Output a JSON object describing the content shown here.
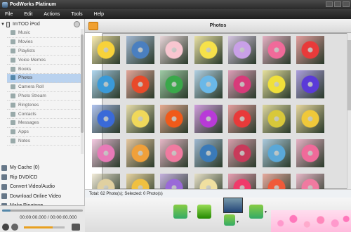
{
  "window": {
    "title": "PodWorks Platinum"
  },
  "menu": [
    "File",
    "Edit",
    "Actions",
    "Tools",
    "Help"
  ],
  "device": {
    "name": "ImTOO iPod"
  },
  "nav": [
    {
      "label": "Music",
      "icon": "music-note-icon"
    },
    {
      "label": "Movies",
      "icon": "film-icon"
    },
    {
      "label": "Playlists",
      "icon": "playlist-icon"
    },
    {
      "label": "Voice Memos",
      "icon": "microphone-icon"
    },
    {
      "label": "Books",
      "icon": "book-icon"
    },
    {
      "label": "Photos",
      "icon": "photo-icon",
      "active": true
    },
    {
      "label": "Camera Roll",
      "icon": "camera-icon"
    },
    {
      "label": "Photo Stream",
      "icon": "cloud-icon"
    },
    {
      "label": "Ringtones",
      "icon": "bell-icon"
    },
    {
      "label": "Contacts",
      "icon": "contacts-icon"
    },
    {
      "label": "Messages",
      "icon": "message-icon"
    },
    {
      "label": "Apps",
      "icon": "apps-icon"
    },
    {
      "label": "Notes",
      "icon": "notes-icon"
    }
  ],
  "tools": [
    {
      "label": "My Cache (0)",
      "icon": "cache-icon"
    },
    {
      "label": "Rip DVD/CD",
      "icon": "disc-icon"
    },
    {
      "label": "Convert Video/Audio",
      "icon": "convert-icon"
    },
    {
      "label": "Download Online Video",
      "icon": "download-icon"
    },
    {
      "label": "Make Ringtone",
      "icon": "ringtone-icon"
    }
  ],
  "player": {
    "time": "00:00:00.000 / 00:00:00.000",
    "progress": 0.1,
    "volume": 0.7
  },
  "main": {
    "title": "Photos",
    "status": "Total: 62 Photo(s); Selected: 0 Photo(s)"
  },
  "photos": [
    "#f7d23a",
    "#4a7fc0",
    "#f8c6d0",
    "#f6e14a",
    "#c9a0e8",
    "#f06a9a",
    "#e83a3a",
    "#3a9ad8",
    "#e84a2a",
    "#3aa84a",
    "#6ab8e8",
    "#d83a7a",
    "#f0e03a",
    "#5a3ad8",
    "#3a6ad8",
    "#f0d85a",
    "#f05a1a",
    "#b83ad8",
    "#e83a3a",
    "#d8c83a",
    "#f0c83a",
    "#e87ab8",
    "#f0a03a",
    "#f07aa0",
    "#3a7ab8",
    "#c83a5a",
    "#5aa8d8",
    "#f06a9a",
    "#e0d0a0",
    "#f0c040",
    "#9a6ad8",
    "#f0e0a0",
    "#f03a6a",
    "#f05a3a",
    "#f07aa0"
  ],
  "colors": {
    "accent": "#f0a030",
    "selection": "#b9d2ef"
  }
}
